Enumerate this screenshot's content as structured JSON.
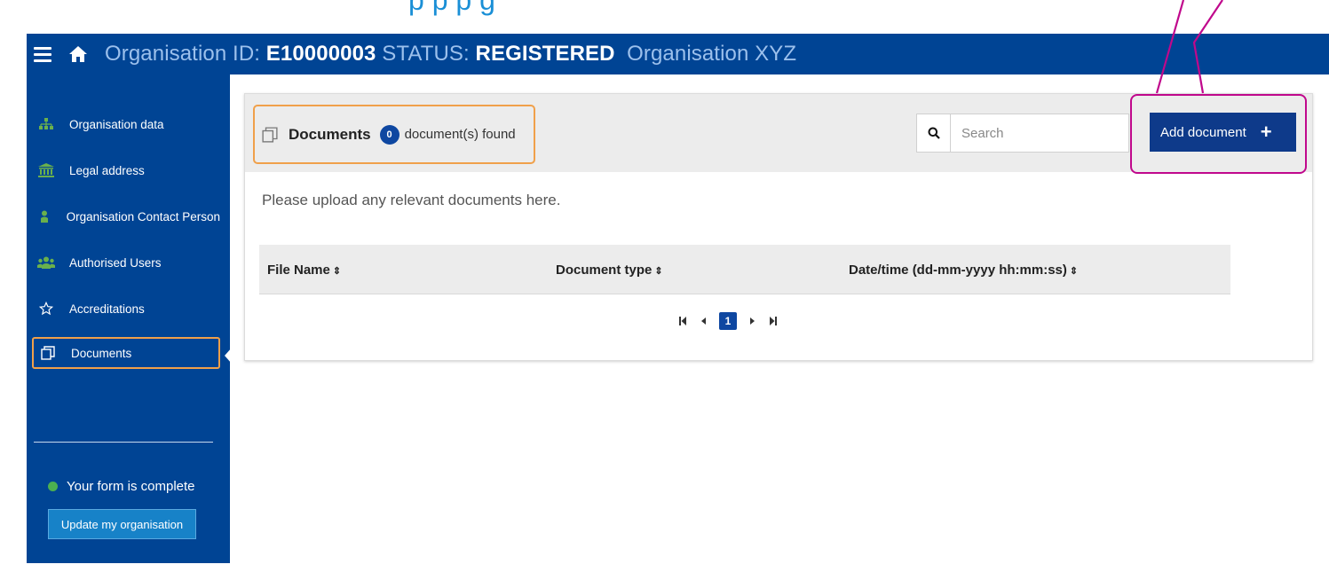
{
  "caption": "p                                                      p  p             g",
  "header": {
    "org_id_label": "Organisation ID:",
    "org_id": "E10000003",
    "status_label": "STATUS:",
    "status": "REGISTERED",
    "org_name": "Organisation XYZ"
  },
  "sidebar": {
    "items": [
      {
        "label": "Organisation data",
        "icon": "sitemap-icon"
      },
      {
        "label": "Legal address",
        "icon": "bank-icon"
      },
      {
        "label": "Organisation Contact Person",
        "icon": "person-icon"
      },
      {
        "label": "Authorised Users",
        "icon": "users-icon"
      },
      {
        "label": "Accreditations",
        "icon": "star-icon"
      },
      {
        "label": "Documents",
        "icon": "documents-icon"
      }
    ],
    "form_status": "Your form is complete",
    "update_button": "Update my organisation"
  },
  "panel": {
    "title": "Documents",
    "count": "0",
    "found_label": "document(s) found",
    "search_placeholder": "Search",
    "add_button": "Add document",
    "add_button_plus": "+",
    "intro": "Please upload any relevant documents here.",
    "columns": [
      "File Name",
      "Document type",
      "Date/time (dd-mm-yyyy hh:mm:ss)"
    ],
    "sort_glyph": "⇕",
    "pagination": {
      "current_page": "1"
    }
  },
  "colors": {
    "brand_blue": "#004494",
    "highlight_orange": "#f0a04a",
    "annotation_magenta": "#c0088c",
    "status_green": "#4caf50"
  }
}
